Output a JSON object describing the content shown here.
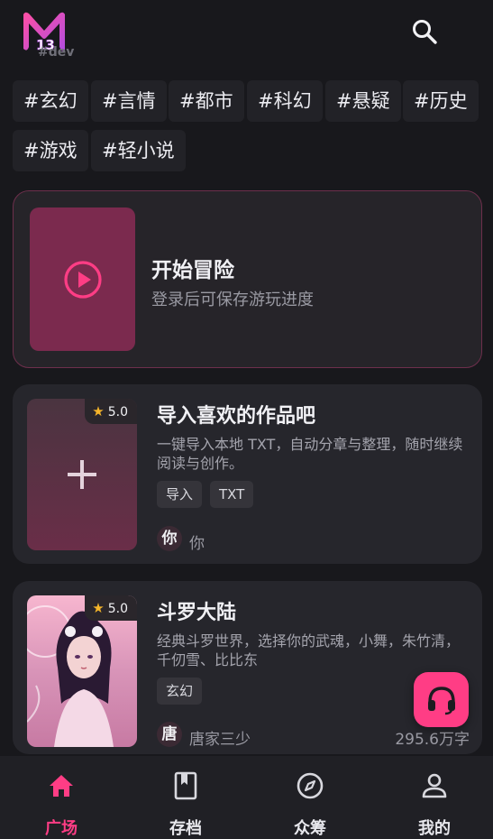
{
  "header": {
    "logo_text": "M13",
    "dev_label": "#dev"
  },
  "tags": [
    "#玄幻",
    "#言情",
    "#都市",
    "#科幻",
    "#悬疑",
    "#历史",
    "#游戏",
    "#轻小说"
  ],
  "adventure": {
    "title": "开始冒险",
    "subtitle": "登录后可保存游玩进度"
  },
  "import_card": {
    "rating": "5.0",
    "title": "导入喜欢的作品吧",
    "description": "一键导入本地 TXT，自动分章与整理，随时继续阅读与创作。",
    "chips": [
      "导入",
      "TXT"
    ],
    "avatar_char": "你",
    "author": "你"
  },
  "novel_card": {
    "rating": "5.0",
    "title": "斗罗大陆",
    "description": "经典斗罗世界，选择你的武魂，小舞，朱竹清，千仞雪、比比东",
    "chips": [
      "玄幻"
    ],
    "avatar_char": "唐",
    "author": "唐家三少",
    "word_count": "295.6万字"
  },
  "bottom_nav": [
    {
      "label": "广场",
      "icon": "home-icon",
      "active": true
    },
    {
      "label": "存档",
      "icon": "bookmark-book-icon",
      "active": false
    },
    {
      "label": "众筹",
      "icon": "compass-icon",
      "active": false
    },
    {
      "label": "我的",
      "icon": "person-icon",
      "active": false
    }
  ],
  "colors": {
    "accent": "#ff3d85",
    "background": "#18181c",
    "card": "#26262c",
    "star": "#f5b52a"
  }
}
